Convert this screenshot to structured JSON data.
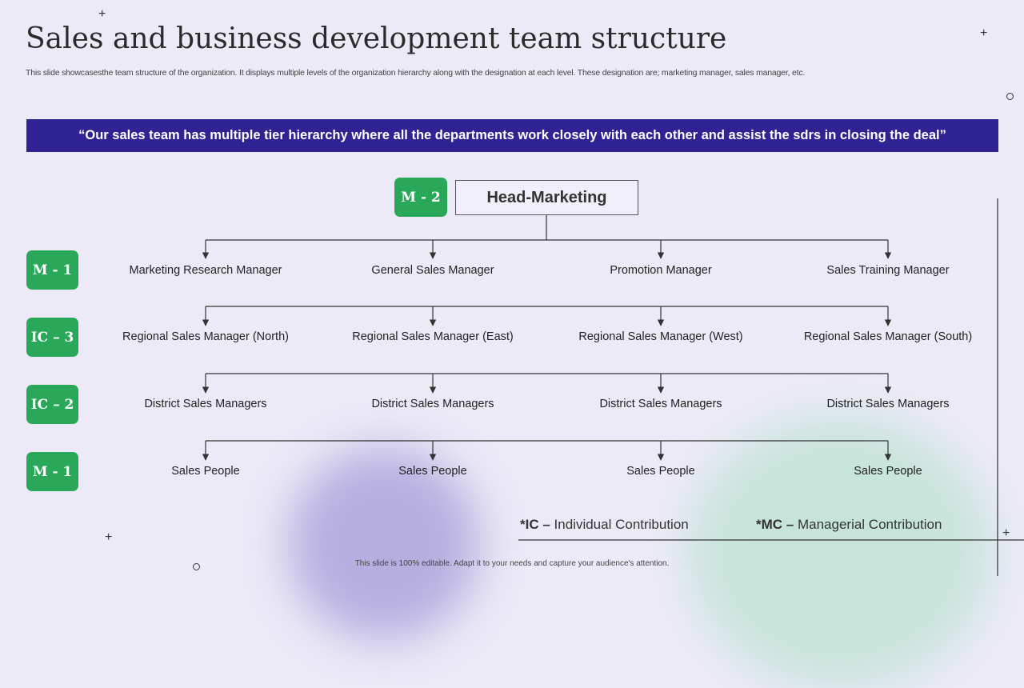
{
  "title": "Sales and business development team structure",
  "subtitle": "This slide showcasesthe team structure of the organization. It displays multiple levels of the organization hierarchy along with the designation at each level. These designation are; marketing manager, sales manager, etc.",
  "banner": "“Our sales team has multiple tier hierarchy where all the departments work closely with each other and assist the sdrs in closing the deal”",
  "head": {
    "badge": "M - 2",
    "label": "Head-Marketing"
  },
  "levels": [
    {
      "badge": "M - 1",
      "nodes": [
        "Marketing  Research Manager",
        "General Sales Manager",
        "Promotion  Manager",
        "Sales Training Manager"
      ]
    },
    {
      "badge": "IC – 3",
      "nodes": [
        "Regional Sales Manager (North)",
        "Regional Sales Manager (East)",
        "Regional Sales Manager (West)",
        "Regional Sales Manager (South)"
      ]
    },
    {
      "badge": "IC – 2",
      "nodes": [
        "District Sales Managers",
        "District Sales Managers",
        "District Sales Managers",
        "District Sales Managers"
      ]
    },
    {
      "badge": "M - 1",
      "nodes": [
        "Sales People",
        "Sales People",
        "Sales People",
        "Sales People"
      ]
    }
  ],
  "legend": {
    "ic_key": "*IC –",
    "ic_text": "Individual Contribution",
    "mc_key": "*MC –",
    "mc_text": "Managerial Contribution"
  },
  "footer": "This slide is 100% editable. Adapt it to your needs and capture your audience's attention.",
  "colors": {
    "banner": "#2f2393",
    "badge": "#29a85a",
    "background": "#eceaf7"
  }
}
